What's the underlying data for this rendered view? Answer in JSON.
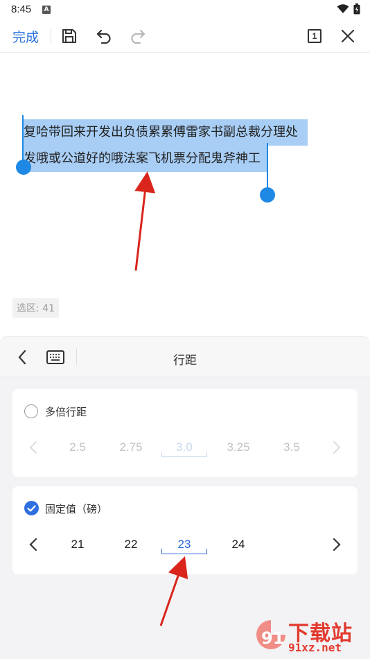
{
  "status": {
    "time": "8:45",
    "app_letter": "A"
  },
  "toolbar": {
    "done_label": "完成",
    "page_badge": "1"
  },
  "document": {
    "line1": "复哈带回来开发出负债累累傅雷家书副总裁分理处",
    "line2": "发哦或公道好的哦法案飞机票分配鬼斧神工",
    "selection_count": "选区: 41"
  },
  "panel": {
    "title": "行距",
    "multiple": {
      "label": "多倍行距",
      "checked": false,
      "options": [
        "2.5",
        "2.75",
        "3.0",
        "3.25",
        "3.5"
      ],
      "selected": "3.0"
    },
    "fixed": {
      "label": "固定值（磅）",
      "checked": true,
      "options": [
        "21",
        "22",
        "23",
        "24"
      ],
      "selected": "23"
    }
  },
  "watermark": {
    "brand": "下载站",
    "domain": "91xz.net",
    "logo_digits": "91"
  },
  "colors": {
    "accent": "#2b73de",
    "selection": "#a8cef6",
    "handle": "#1e88e5",
    "annotation_arrow": "#d9251c"
  }
}
